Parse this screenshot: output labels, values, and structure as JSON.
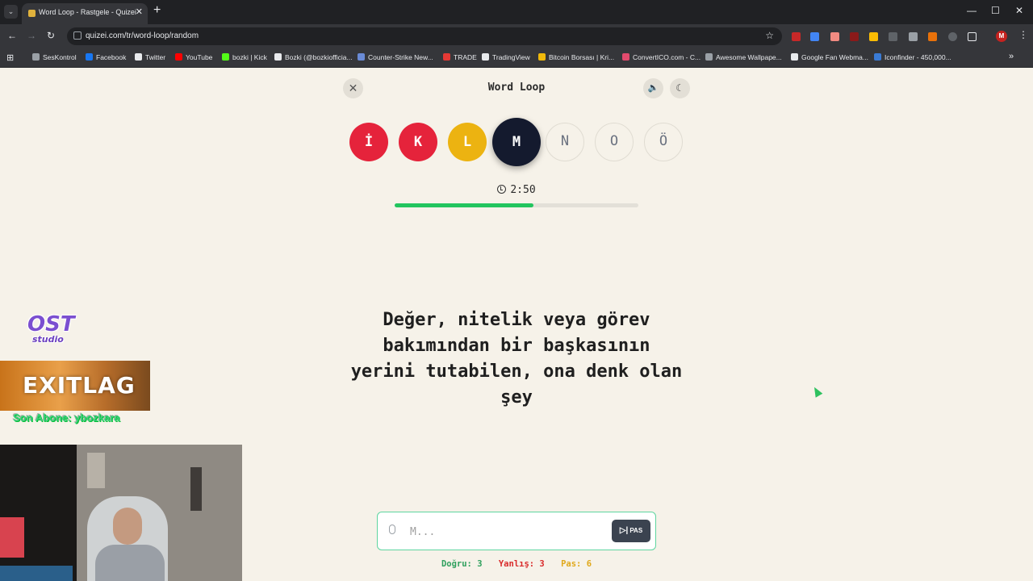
{
  "browser": {
    "tab_title": "Word Loop - Rastgele - Quizei",
    "url": "quizei.com/tr/word-loop/random",
    "new_tab": "+",
    "bookmarks": [
      {
        "label": "SesKontrol",
        "color": "#9aa0a6"
      },
      {
        "label": "Facebook",
        "color": "#1877f2"
      },
      {
        "label": "Twitter",
        "color": "#e8eaed"
      },
      {
        "label": "YouTube",
        "color": "#ff0000"
      },
      {
        "label": "bozki | Kick",
        "color": "#53fc18"
      },
      {
        "label": "Bozki (@bozkiofficia...",
        "color": "#e8eaed"
      },
      {
        "label": "Counter-Strike New...",
        "color": "#6a8bd6"
      },
      {
        "label": "TRADE",
        "color": "#e53935"
      },
      {
        "label": "TradingView",
        "color": "#e8eaed"
      },
      {
        "label": "Bitcoin Borsası | Kri...",
        "color": "#f0b90b"
      },
      {
        "label": "ConvertICO.com - C...",
        "color": "#e24a6d"
      },
      {
        "label": "Awesome Wallpape...",
        "color": "#9aa0a6"
      },
      {
        "label": "Google Fan Webma...",
        "color": "#e8eaed"
      },
      {
        "label": "Iconfinder - 450,000...",
        "color": "#3a7bd5"
      }
    ],
    "profile_initial": "M"
  },
  "game": {
    "title": "Word Loop",
    "letters": [
      {
        "char": "İ",
        "state": "wrong"
      },
      {
        "char": "K",
        "state": "wrong"
      },
      {
        "char": "L",
        "state": "passed"
      },
      {
        "char": "M",
        "state": "active"
      },
      {
        "char": "N",
        "state": "pending"
      },
      {
        "char": "O",
        "state": "pending"
      },
      {
        "char": "Ö",
        "state": "pending"
      }
    ],
    "timer": "2:50",
    "time_progress": 0.57,
    "clue": "Değer, nitelik veya görev bakımından bir başkasının yerini tutabilen, ona denk olan şey",
    "input": {
      "placeholder": "M...",
      "value": ""
    },
    "pass_label": "PAS",
    "stats": {
      "correct": "Doğru: 3",
      "wrong": "Yanlış: 3",
      "pass": "Pas: 6"
    }
  },
  "overlay": {
    "ost_logo": "OST",
    "ost_sub": "studio",
    "sponsor": "EXITLAG",
    "last_sub": "Son Abone: ybozkara"
  },
  "colors": {
    "wrong": "#e5233b",
    "passed": "#ecb311",
    "active": "#141a2e",
    "progress": "#22c55e",
    "accent_border": "#5fd5a0"
  }
}
